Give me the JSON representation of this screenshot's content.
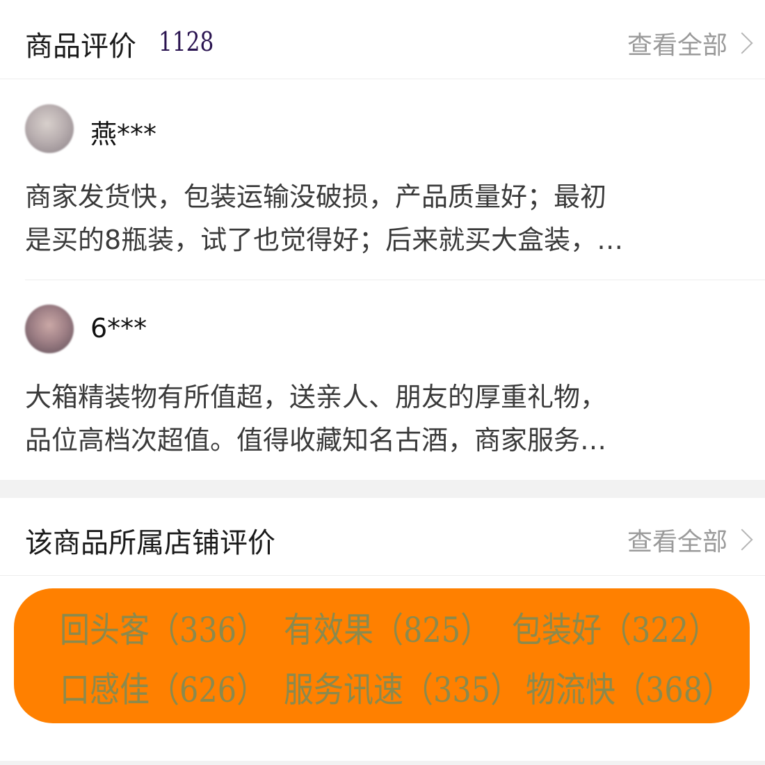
{
  "product_reviews": {
    "title": "商品评价",
    "count": "1128",
    "view_all": "查看全部",
    "reviews": [
      {
        "username": "燕***",
        "text_line1": "商家发货快，包装运输没破损，产品质量好；最初",
        "text_line2": "是买的8瓶装，试了也觉得好；后来就买大盒装，…"
      },
      {
        "username": "6***",
        "text_line1": "大箱精装物有所值超，送亲人、朋友的厚重礼物，",
        "text_line2": "品位高档次超值。值得收藏知名古酒，商家服务…"
      }
    ]
  },
  "store_reviews": {
    "title": "该商品所属店铺评价",
    "view_all": "查看全部",
    "tags": [
      "回头客（336）",
      "有效果（825）",
      "包装好（322）",
      "口感佳（626）",
      "服务讯速（335）",
      "物流快（368）"
    ]
  },
  "colors": {
    "tag_panel_bg": "#ff8000",
    "tag_text": "#8a8a4e",
    "count_text": "#2a1450"
  }
}
